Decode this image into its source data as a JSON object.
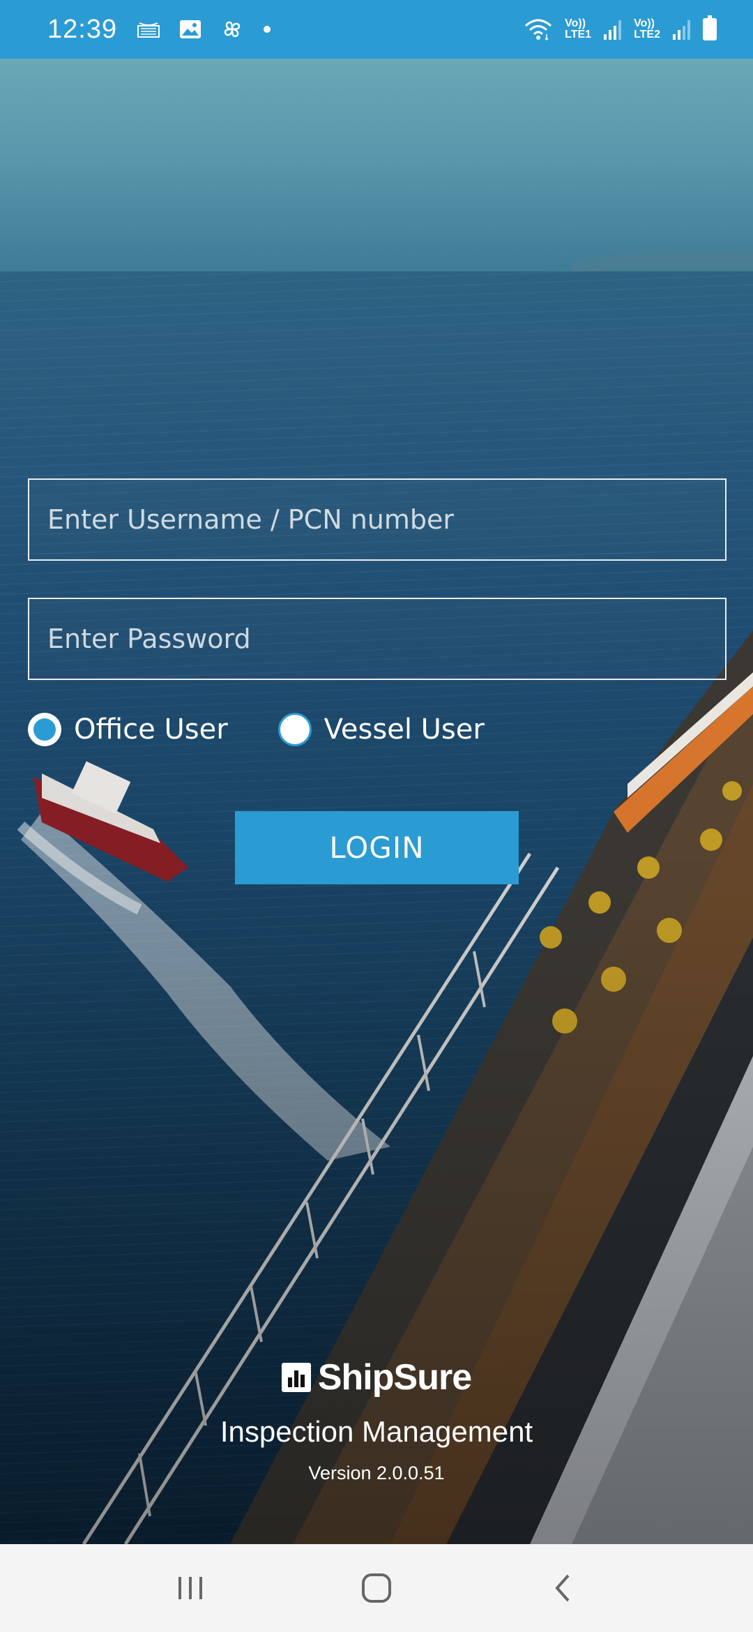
{
  "status_bar": {
    "time": "12:39",
    "left_icons": [
      "amazon-icon",
      "image-icon",
      "pinwheel-icon",
      "dot-icon"
    ],
    "sim1": {
      "top": "Vo))",
      "bottom": "LTE1"
    },
    "sim2": {
      "top": "Vo))",
      "bottom": "LTE2"
    },
    "right_icons": [
      "wifi-icon",
      "signal-icon",
      "signal-icon",
      "battery-icon"
    ]
  },
  "login_form": {
    "username_placeholder": "Enter Username / PCN number",
    "password_placeholder": "Enter Password",
    "user_types": [
      {
        "label": "Office User",
        "selected": true
      },
      {
        "label": "Vessel User",
        "selected": false
      }
    ],
    "login_label": "LOGIN"
  },
  "branding": {
    "logo_text": "ShipSure",
    "subtitle": "Inspection Management",
    "version": "Version 2.0.0.51"
  },
  "nav_bar": {
    "icons": [
      "recent-apps-icon",
      "home-icon",
      "back-icon"
    ]
  },
  "colors": {
    "accent": "#2b9bd4",
    "nav_bg": "#f4f4f4"
  }
}
